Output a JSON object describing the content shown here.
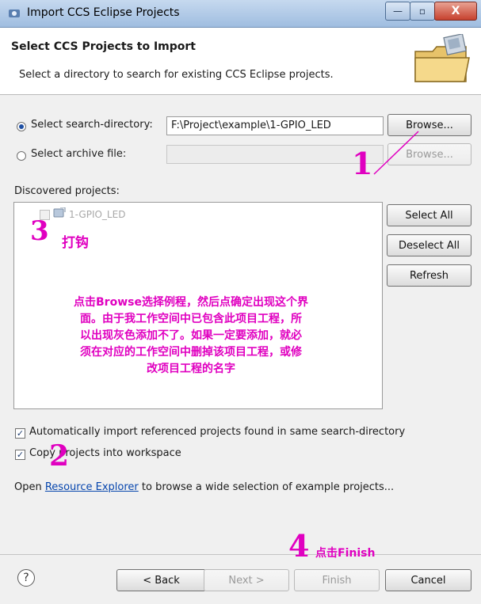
{
  "window": {
    "title": "Import CCS Eclipse Projects",
    "min_symbol": "—",
    "max_symbol": "▫",
    "close_symbol": "X"
  },
  "banner": {
    "title": "Select CCS Projects to Import",
    "description": "Select a directory to search for existing CCS Eclipse projects."
  },
  "search": {
    "label": "Select search-directory:",
    "value": "F:\\Project\\example\\1-GPIO_LED",
    "browse": "Browse...",
    "selected": true
  },
  "archive": {
    "label": "Select archive file:",
    "value": "",
    "browse": "Browse...",
    "selected": false
  },
  "discovered": {
    "label": "Discovered projects:",
    "items": [
      {
        "name": "1-GPIO_LED",
        "checked": false,
        "disabled": true
      }
    ]
  },
  "side_buttons": {
    "select_all": "Select All",
    "deselect_all": "Deselect All",
    "refresh": "Refresh"
  },
  "options": {
    "auto_import": "Automatically import referenced projects found in same search-directory",
    "copy_projects": "Copy projects into workspace",
    "auto_import_checked": true,
    "copy_checked": true
  },
  "resource_line": {
    "prefix": "Open ",
    "link": "Resource Explorer",
    "suffix": " to browse a wide selection of example projects..."
  },
  "footer": {
    "help": "?",
    "back": "< Back",
    "next": "Next >",
    "finish": "Finish",
    "cancel": "Cancel"
  },
  "annotations": {
    "n1": "1",
    "n2": "2",
    "n3": "3",
    "n3_text": "打钩",
    "n4": "4",
    "n4_text": "点击Finish",
    "explanation": [
      "点击Browse选择例程，然后点确定出现这个界",
      "面。由于我工作空间中已包含此项目工程，所",
      "以出现灰色添加不了。如果一定要添加，就必",
      "须在对应的工作空间中删掉该项目工程，或修",
      "改项目工程的名字"
    ],
    "color": "#e000c0"
  }
}
